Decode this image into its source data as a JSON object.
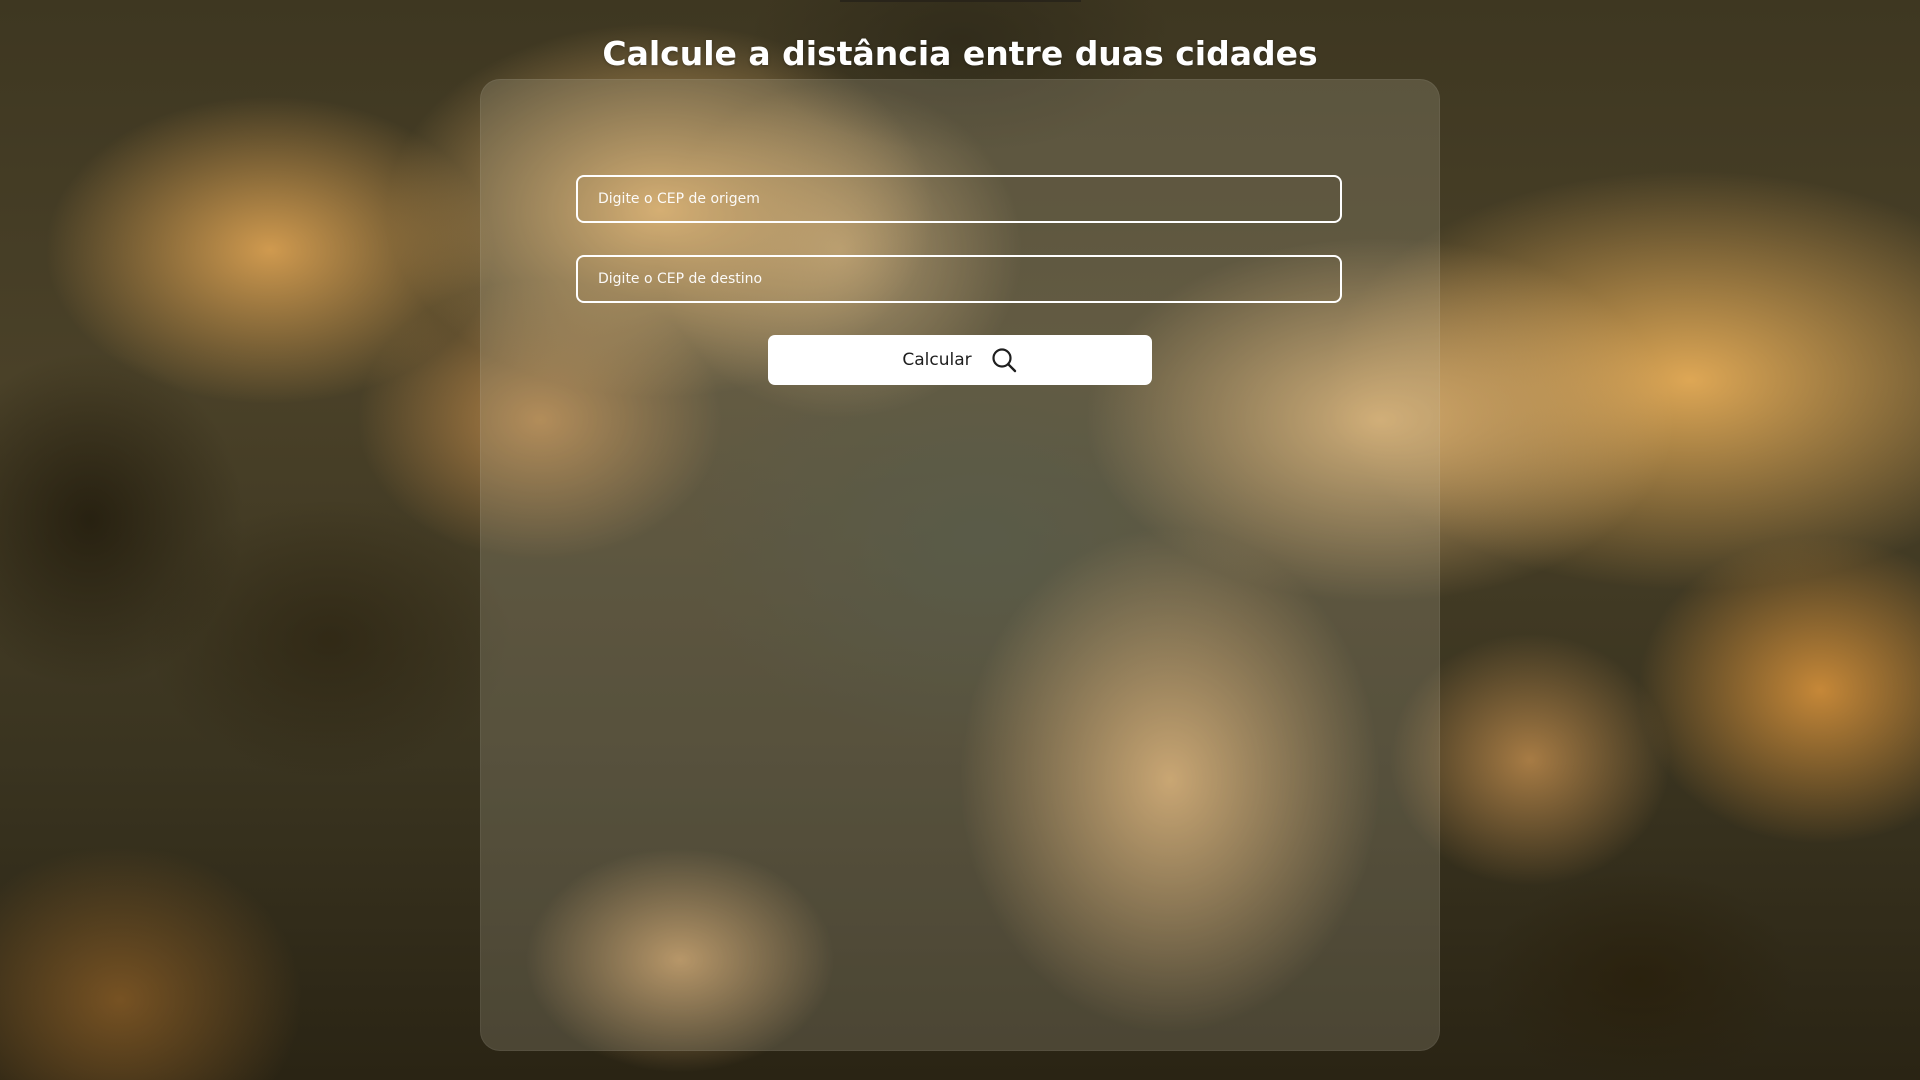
{
  "page": {
    "title": "Calcule a distância entre duas cidades"
  },
  "form": {
    "origin_placeholder": "Digite o CEP de origem",
    "origin_value": "",
    "destination_placeholder": "Digite o CEP de destino",
    "destination_value": "",
    "submit_label": "Calcular",
    "submit_icon": "search-icon"
  },
  "colors": {
    "title_text": "#ffffff",
    "input_border": "#ffffff",
    "button_background": "#ffffff",
    "button_text": "#1e1e1e"
  }
}
